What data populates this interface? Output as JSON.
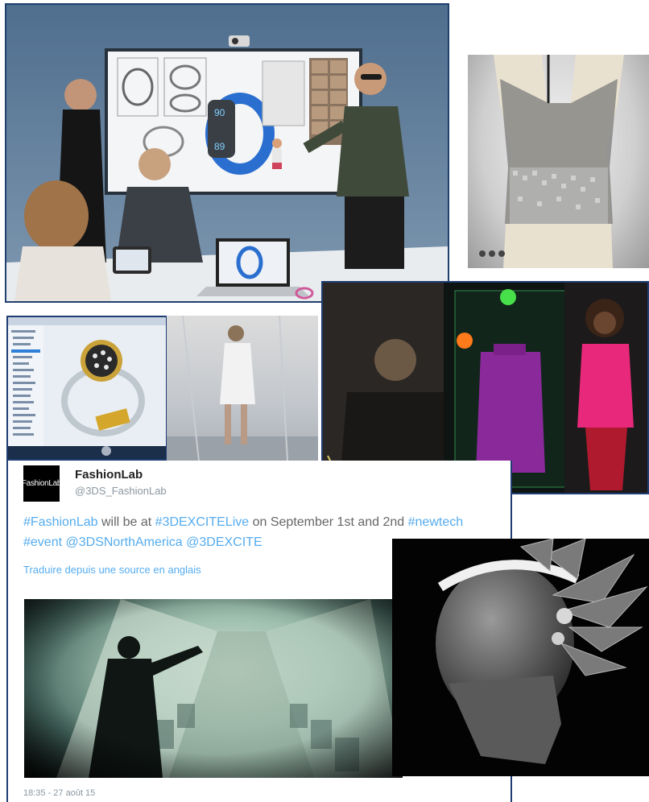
{
  "tweet": {
    "avatar_text": "FashionLab",
    "name": "FashionLab",
    "handle": "@3DS_FashionLab",
    "text_parts": [
      {
        "t": "#FashionLab",
        "tag": true
      },
      {
        "t": " will be at ",
        "tag": false
      },
      {
        "t": "#3DEXCITELive",
        "tag": true
      },
      {
        "t": " on September 1st and 2nd ",
        "tag": false
      },
      {
        "t": "#newtech",
        "tag": true
      },
      {
        "t": " ",
        "tag": false
      },
      {
        "t": "#event",
        "tag": true
      },
      {
        "t": " ",
        "tag": false
      },
      {
        "t": "@3DSNorthAmerica",
        "tag": true
      },
      {
        "t": " ",
        "tag": false
      },
      {
        "t": "@3DEXCITE",
        "tag": true
      }
    ],
    "translate": "Traduire depuis une source en anglais",
    "timestamp": "18:35 - 27 août 15"
  },
  "screen": {
    "tracker_value_top": "90",
    "tracker_value_bottom": "89"
  },
  "colors": {
    "frame_blue": "#1f3d73",
    "twitter_blue": "#55acee",
    "hot_pink": "#e8287a",
    "purple": "#8a2a9a"
  }
}
